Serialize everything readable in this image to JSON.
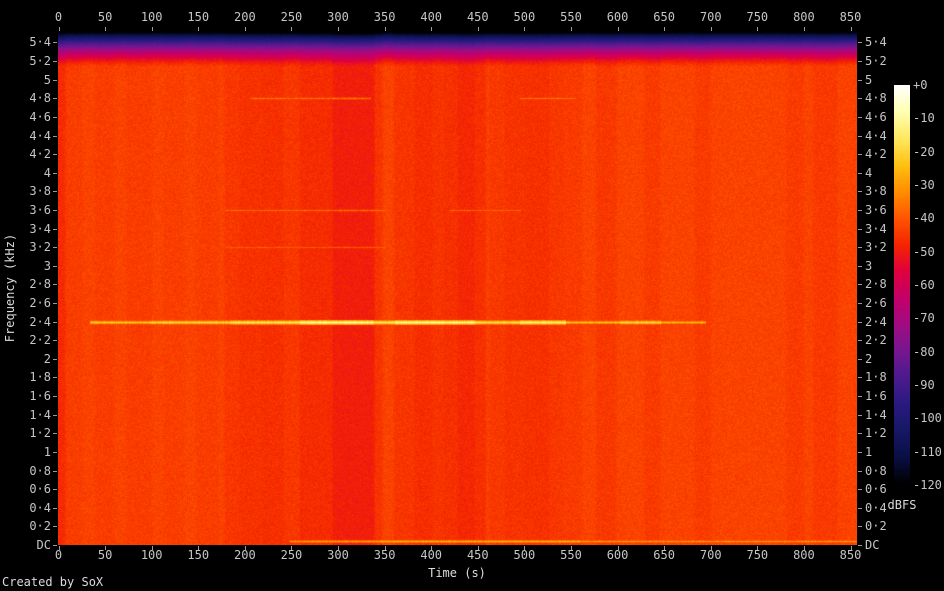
{
  "credit": "Created by SoX",
  "axes": {
    "time": {
      "label": "Time (s)",
      "unit": "s",
      "ticks": [
        0,
        50,
        100,
        150,
        200,
        250,
        300,
        350,
        400,
        450,
        500,
        550,
        600,
        650,
        700,
        750,
        800,
        850
      ]
    },
    "frequency": {
      "label": "Frequency (kHz)",
      "unit": "kHz",
      "tick_step_khz": 0.2,
      "tick_labels": [
        "DC",
        "0·2",
        "0·4",
        "0·6",
        "0·8",
        "1",
        "1·2",
        "1·4",
        "1·6",
        "1·8",
        "2",
        "2·2",
        "2·4",
        "2·6",
        "2·8",
        "3",
        "3·2",
        "3·4",
        "3·6",
        "3·8",
        "4",
        "4·2",
        "4·4",
        "4·6",
        "4·8",
        "5",
        "5·2",
        "5·4"
      ]
    },
    "colorbar": {
      "unit": "dBFS",
      "range_db": [
        0,
        -120
      ],
      "tick_labels": [
        "+0",
        "-10",
        "-20",
        "-30",
        "-40",
        "-50",
        "-60",
        "-70",
        "-80",
        "-90",
        "-100",
        "-110",
        "-120"
      ]
    }
  },
  "chart_data": {
    "type": "heatmap",
    "subtype": "audio-spectrogram",
    "title": "",
    "x_axis": {
      "label": "Time (s)",
      "range": [
        0,
        857
      ]
    },
    "y_axis": {
      "label": "Frequency (kHz)",
      "range": [
        0,
        5.5125
      ]
    },
    "z_axis": {
      "label": "dBFS",
      "range": [
        -120,
        0
      ]
    },
    "duration_s": 857,
    "freq_max_khz": 5.5125,
    "base_db": -43,
    "noise_db": 2.4,
    "band_feather_s": 4,
    "top_fade": {
      "start_khz": 5.14,
      "depth_db": 76,
      "exponent": 1.4
    },
    "palette": [
      {
        "db": 0,
        "color": "#ffffff"
      },
      {
        "db": -8,
        "color": "#ffffb2"
      },
      {
        "db": -16,
        "color": "#ffe95f"
      },
      {
        "db": -24,
        "color": "#ffc113"
      },
      {
        "db": -32,
        "color": "#ff8e00"
      },
      {
        "db": -40,
        "color": "#ff5500"
      },
      {
        "db": -48,
        "color": "#f52500"
      },
      {
        "db": -56,
        "color": "#e00040"
      },
      {
        "db": -64,
        "color": "#c3006a"
      },
      {
        "db": -72,
        "color": "#a00d83"
      },
      {
        "db": -80,
        "color": "#761790"
      },
      {
        "db": -88,
        "color": "#4c1a8e"
      },
      {
        "db": -96,
        "color": "#2a1a80"
      },
      {
        "db": -104,
        "color": "#161866"
      },
      {
        "db": -112,
        "color": "#0a0f42"
      },
      {
        "db": -120,
        "color": "#000000"
      }
    ],
    "vertical_bands": [
      {
        "t0": 0,
        "t1": 6,
        "delta_db": -4
      },
      {
        "t0": 4,
        "t1": 24,
        "delta_db": -1
      },
      {
        "t0": 41,
        "t1": 58,
        "delta_db": -1
      },
      {
        "t0": 75,
        "t1": 99,
        "delta_db": -1
      },
      {
        "t0": 115,
        "t1": 133,
        "delta_db": -0.8
      },
      {
        "t0": 150,
        "t1": 170,
        "delta_db": -1
      },
      {
        "t0": 180,
        "t1": 195,
        "delta_db": -2
      },
      {
        "t0": 195,
        "t1": 219,
        "delta_db": -2.8
      },
      {
        "t0": 219,
        "t1": 241,
        "delta_db": -3.2
      },
      {
        "t0": 241,
        "t1": 260,
        "delta_db": -2
      },
      {
        "t0": 260,
        "t1": 295,
        "delta_db": -3.8
      },
      {
        "t0": 295,
        "t1": 338,
        "delta_db": -6.3
      },
      {
        "t0": 338,
        "t1": 346,
        "delta_db": -2.5
      },
      {
        "t0": 362,
        "t1": 383,
        "delta_db": -2.2
      },
      {
        "t0": 383,
        "t1": 401,
        "delta_db": -3.5
      },
      {
        "t0": 401,
        "t1": 414,
        "delta_db": -2.5
      },
      {
        "t0": 414,
        "t1": 429,
        "delta_db": -3.2
      },
      {
        "t0": 429,
        "t1": 446,
        "delta_db": -4.6
      },
      {
        "t0": 446,
        "t1": 457,
        "delta_db": -3.2
      },
      {
        "t0": 464,
        "t1": 480,
        "delta_db": -1.8
      },
      {
        "t0": 480,
        "t1": 501,
        "delta_db": -2.6
      },
      {
        "t0": 501,
        "t1": 526,
        "delta_db": -3
      },
      {
        "t0": 526,
        "t1": 541,
        "delta_db": -2
      },
      {
        "t0": 541,
        "t1": 560,
        "delta_db": -1.4
      },
      {
        "t0": 579,
        "t1": 597,
        "delta_db": -1.8
      },
      {
        "t0": 631,
        "t1": 644,
        "delta_db": -1.4
      },
      {
        "t0": 685,
        "t1": 698,
        "delta_db": -1.4
      },
      {
        "t0": 783,
        "t1": 798,
        "delta_db": -1.3
      },
      {
        "t0": 812,
        "t1": 834,
        "delta_db": -1.6
      }
    ],
    "tonal_lines": [
      {
        "freq_khz": 2.4,
        "segments": [
          {
            "t0": 34,
            "t1": 99,
            "db": -22
          },
          {
            "t0": 99,
            "t1": 185,
            "db": -19
          },
          {
            "t0": 185,
            "t1": 260,
            "db": -15
          },
          {
            "t0": 260,
            "t1": 337,
            "db": -9
          },
          {
            "t0": 337,
            "t1": 362,
            "db": -14
          },
          {
            "t0": 362,
            "t1": 447,
            "db": -10
          },
          {
            "t0": 447,
            "t1": 496,
            "db": -17
          },
          {
            "t0": 496,
            "t1": 544,
            "db": -12
          },
          {
            "t0": 544,
            "t1": 603,
            "db": -24
          },
          {
            "t0": 603,
            "t1": 646,
            "db": -19
          },
          {
            "t0": 646,
            "t1": 694,
            "db": -26
          }
        ]
      },
      {
        "freq_khz": 4.8,
        "segments": [
          {
            "t0": 206,
            "t1": 335,
            "db": -36
          },
          {
            "t0": 496,
            "t1": 555,
            "db": -36
          }
        ]
      },
      {
        "freq_khz": 3.6,
        "segments": [
          {
            "t0": 179,
            "t1": 351,
            "db": -37
          },
          {
            "t0": 421,
            "t1": 496,
            "db": -38
          }
        ]
      },
      {
        "freq_khz": 3.2,
        "segments": [
          {
            "t0": 179,
            "t1": 351,
            "db": -39.5
          }
        ]
      },
      {
        "freq_khz": 0.04,
        "segments": [
          {
            "t0": 249,
            "t1": 346,
            "db": -30
          },
          {
            "t0": 346,
            "t1": 560,
            "db": -27
          },
          {
            "t0": 560,
            "t1": 857,
            "db": -31
          }
        ]
      }
    ]
  },
  "colors": {
    "background": "#000000",
    "tick_text": "#c6c6c6",
    "axis_text": "#dcdcdc",
    "tick_mark": "#9a9a9a"
  }
}
